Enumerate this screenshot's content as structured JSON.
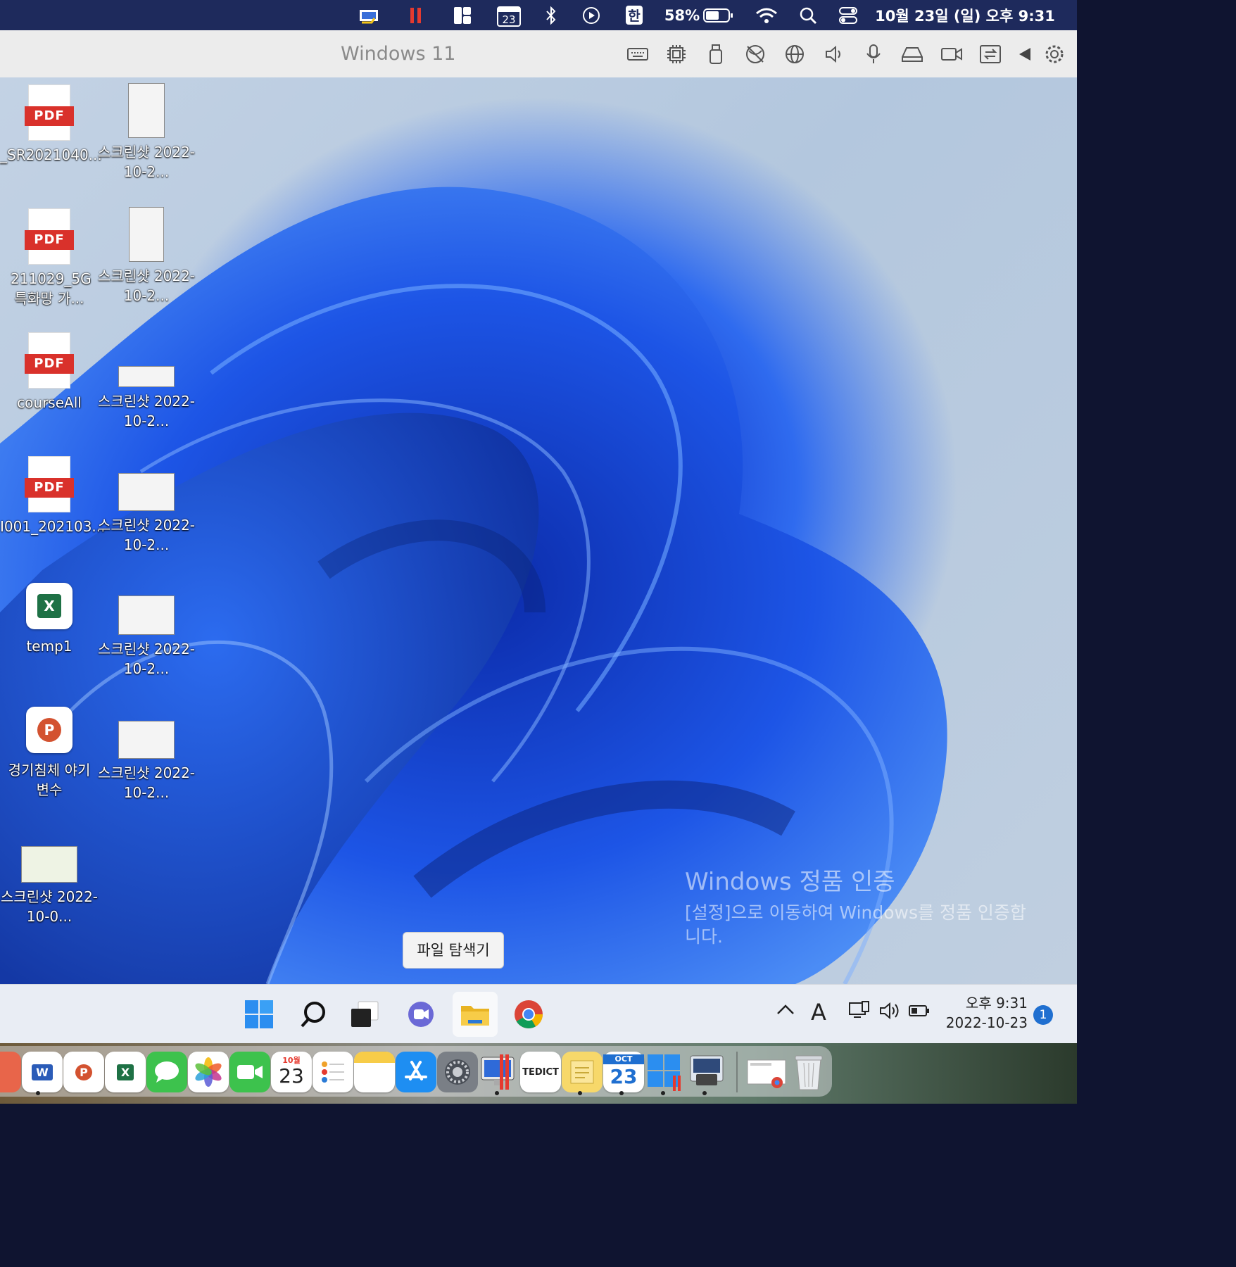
{
  "menubar": {
    "battery_percent": "58%",
    "input_method": "한",
    "calendar_day": "23",
    "datetime": "10월 23일 (일) 오후 9:31"
  },
  "parallels": {
    "title": "Windows 11",
    "toolbar_icons": [
      "keyboard-icon",
      "cpu-icon",
      "usb-icon",
      "network-off-icon",
      "globe-icon",
      "speaker-icon",
      "microphone-icon",
      "drive-icon",
      "camera-icon",
      "share-icon",
      "back-icon",
      "settings-icon"
    ]
  },
  "desktop": {
    "col1": [
      {
        "type": "pdf",
        "badge": "PDF",
        "label": "_SR2021040..."
      },
      {
        "type": "pdf",
        "badge": "PDF",
        "label": "211029_5G 특화망 가..."
      },
      {
        "type": "pdf",
        "badge": "PDF",
        "label": "courseAll"
      },
      {
        "type": "pdf",
        "badge": "PDF",
        "label": "I001_202103..."
      },
      {
        "type": "excel",
        "badge": "X",
        "label": "temp1"
      },
      {
        "type": "powerpoint",
        "badge": "P",
        "label": "경기침체 야기 변수"
      },
      {
        "type": "screenshot",
        "label": "스크린샷 2022-10-0..."
      }
    ],
    "col2": [
      {
        "label": "스크린샷 2022-10-2..."
      },
      {
        "label": "스크린샷 2022-10-2..."
      },
      {
        "label": "스크린샷 2022-10-2..."
      },
      {
        "label": "스크린샷 2022-10-2..."
      },
      {
        "label": "스크린샷 2022-10-2..."
      },
      {
        "label": "스크린샷 2022-10-2..."
      }
    ]
  },
  "watermark": {
    "title": "Windows 정품 인증",
    "subtitle": "[설정]으로 이동하여 Windows를 정품 인증합니다."
  },
  "tooltip": "파일 탐색기",
  "taskbar": {
    "apps": [
      "start-icon",
      "search-icon",
      "task-view-icon",
      "teams-icon",
      "file-explorer-icon",
      "chrome-icon"
    ],
    "ime": "A",
    "time": "오후 9:31",
    "date": "2022-10-23",
    "notifications": "1"
  },
  "dock": {
    "calendar_month": "10월",
    "calendar_day": "23",
    "calendar2_month": "OCT",
    "calendar2_day": "23",
    "tedict_label": "TEDICT",
    "word_badge": "W",
    "ppt_badge": "P",
    "excel_badge": "X"
  },
  "colors": {
    "menubar_bg": "#1e2a5c",
    "desktop_wave": "#1a47d6",
    "pdf_badge": "#d9312b",
    "excel_green": "#1e7145",
    "ppt_orange": "#d35230",
    "notification_blue": "#1f6fd0"
  }
}
